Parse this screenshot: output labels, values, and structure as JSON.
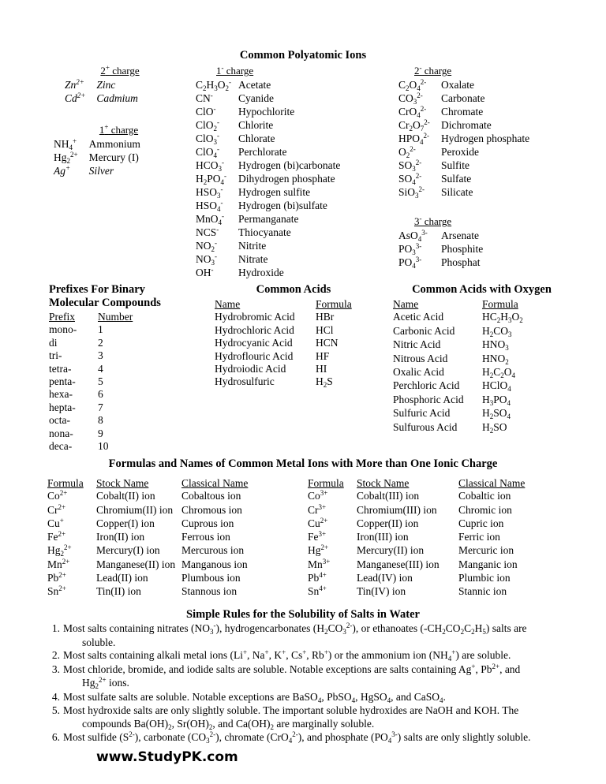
{
  "document": {
    "footer_brand": "www.StudyPK.com"
  },
  "polyatomic": {
    "title": "Common Polyatomic Ions",
    "groups": {
      "cat2": {
        "heading_charge": "2",
        "heading_sign": "+",
        "heading_word": "charge",
        "rows": [
          {
            "formula_base": "Zn",
            "formula_sup": "2+",
            "name": "Zinc",
            "italic": true
          },
          {
            "formula_base": "Cd",
            "formula_sup": "2+",
            "name": "Cadmium",
            "italic": true
          }
        ]
      },
      "cat1": {
        "heading_charge": "1",
        "heading_sign": "+",
        "heading_word": "charge",
        "rows": [
          {
            "formula_base": "NH",
            "formula_sub": "4",
            "formula_sup": "+",
            "name": "Ammonium",
            "italic": false
          },
          {
            "formula_base": "Hg",
            "formula_sub": "2",
            "formula_sup": "2+",
            "name": "Mercury (I)",
            "italic": false
          },
          {
            "formula_base": "Ag",
            "formula_sup": "+",
            "name": "Silver",
            "italic": true
          }
        ]
      },
      "an1": {
        "heading_charge": "1",
        "heading_sign": "-",
        "heading_word": "charge",
        "rows": [
          {
            "formula": "C2H3O2^-",
            "name": "Acetate"
          },
          {
            "formula": "CN^-",
            "name": "Cyanide"
          },
          {
            "formula": "ClO^-",
            "name": "Hypochlorite"
          },
          {
            "formula": "ClO2^-",
            "name": "Chlorite"
          },
          {
            "formula": "ClO3^-",
            "name": "Chlorate"
          },
          {
            "formula": "ClO4^-",
            "name": "Perchlorate"
          },
          {
            "formula": "HCO3^-",
            "name": "Hydrogen (bi)carbonate"
          },
          {
            "formula": "H2PO4^-",
            "name": "Dihydrogen phosphate"
          },
          {
            "formula": "HSO3^-",
            "name": "Hydrogen sulfite"
          },
          {
            "formula": "HSO4^-",
            "name": "Hydrogen (bi)sulfate"
          },
          {
            "formula": "MnO4^-",
            "name": "Permanganate"
          },
          {
            "formula": "NCS^-",
            "name": "Thiocyanate"
          },
          {
            "formula": "NO2^-",
            "name": "Nitrite"
          },
          {
            "formula": "NO3^-",
            "name": "Nitrate"
          },
          {
            "formula": "OH^-",
            "name": "Hydroxide"
          }
        ]
      },
      "an2": {
        "heading_charge": "2",
        "heading_sign": "-",
        "heading_word": "charge",
        "rows": [
          {
            "formula": "C2O4^2-",
            "name": "Oxalate"
          },
          {
            "formula": "CO3^2-",
            "name": "Carbonate"
          },
          {
            "formula": "CrO4^2-",
            "name": "Chromate"
          },
          {
            "formula": "Cr2O7^2-",
            "name": "Dichromate"
          },
          {
            "formula": "HPO4^2-",
            "name": "Hydrogen phosphate"
          },
          {
            "formula": "O2^2-",
            "name": "Peroxide"
          },
          {
            "formula": "SO3^2-",
            "name": "Sulfite"
          },
          {
            "formula": "SO4^2-",
            "name": "Sulfate"
          },
          {
            "formula": "SiO3^2-",
            "name": "Silicate"
          }
        ]
      },
      "an3": {
        "heading_charge": "3",
        "heading_sign": "-",
        "heading_word": "charge",
        "rows": [
          {
            "formula": "AsO4^3-",
            "name": "Arsenate"
          },
          {
            "formula": "PO3^3-",
            "name": "Phosphite"
          },
          {
            "formula": "PO4^3-",
            "name": "Phosphat"
          }
        ]
      }
    }
  },
  "prefixes": {
    "title_line1": "Prefixes For Binary",
    "title_line2": "Molecular Compounds",
    "col_prefix": "Prefix",
    "col_number": "Number",
    "rows": [
      {
        "prefix": "mono-",
        "number": "1"
      },
      {
        "prefix": "di",
        "number": "2"
      },
      {
        "prefix": "tri-",
        "number": "3"
      },
      {
        "prefix": "tetra-",
        "number": "4"
      },
      {
        "prefix": "penta-",
        "number": "5"
      },
      {
        "prefix": "hexa-",
        "number": "6"
      },
      {
        "prefix": "hepta-",
        "number": "7"
      },
      {
        "prefix": "octa-",
        "number": "8"
      },
      {
        "prefix": "nona-",
        "number": "9"
      },
      {
        "prefix": "deca-",
        "number": "10"
      }
    ]
  },
  "acids": {
    "title": "Common Acids",
    "col_name": "Name",
    "col_formula": "Formula",
    "rows": [
      {
        "name": "Hydrobromic Acid",
        "formula": "HBr"
      },
      {
        "name": "Hydrochloric Acid",
        "formula": "HCl"
      },
      {
        "name": "Hydrocyanic Acid",
        "formula": "HCN"
      },
      {
        "name": "Hydroflouric Acid",
        "formula": "HF"
      },
      {
        "name": "Hydroiodic Acid",
        "formula": "HI"
      },
      {
        "name": "Hydrosulfuric",
        "formula": "H2S"
      }
    ]
  },
  "oxyacids": {
    "title": "Common Acids with Oxygen",
    "col_name": "Name",
    "col_formula": "Formula",
    "rows": [
      {
        "name": "Acetic Acid",
        "formula": "HC2H3O2"
      },
      {
        "name": "Carbonic Acid",
        "formula": "H2CO3"
      },
      {
        "name": "Nitric Acid",
        "formula": "HNO3"
      },
      {
        "name": "Nitrous Acid",
        "formula": "HNO2"
      },
      {
        "name": "Oxalic Acid",
        "formula": "H2C2O4"
      },
      {
        "name": "Perchloric Acid",
        "formula": "HClO4"
      },
      {
        "name": "Phosphoric Acid",
        "formula": "H3PO4"
      },
      {
        "name": "Sulfuric Acid",
        "formula": "H2SO4"
      },
      {
        "name": "Sulfurous Acid",
        "formula": "H2SO"
      }
    ]
  },
  "metal_ions": {
    "title": "Formulas and Names of Common Metal Ions with More than One Ionic Charge",
    "col_formula": "Formula",
    "col_stock": "Stock Name",
    "col_classical": "Classical Name",
    "left_rows": [
      {
        "formula": "Co^2+",
        "stock": "Cobalt(II) ion",
        "classical": "Cobaltous ion"
      },
      {
        "formula": "Cr^2+",
        "stock": "Chromium(II) ion",
        "classical": "Chromous ion"
      },
      {
        "formula": "Cu^+",
        "stock": "Copper(I) ion",
        "classical": "Cuprous ion"
      },
      {
        "formula": "Fe^2+",
        "stock": "Iron(II) ion",
        "classical": "Ferrous ion"
      },
      {
        "formula": "Hg2^2+",
        "stock": "Mercury(I) ion",
        "classical": "Mercurous ion"
      },
      {
        "formula": "Mn^2+",
        "stock": "Manganese(II) ion",
        "classical": "Manganous ion"
      },
      {
        "formula": "Pb^2+",
        "stock": "Lead(II) ion",
        "classical": "Plumbous ion"
      },
      {
        "formula": "Sn^2+",
        "stock": "Tin(II) ion",
        "classical": "Stannous ion"
      }
    ],
    "right_rows": [
      {
        "formula": "Co^3+",
        "stock": "Cobalt(III) ion",
        "classical": "Cobaltic ion"
      },
      {
        "formula": "Cr^3+",
        "stock": "Chromium(III) ion",
        "classical": "Chromic ion"
      },
      {
        "formula": "Cu^2+",
        "stock": "Copper(II) ion",
        "classical": "Cupric ion"
      },
      {
        "formula": "Fe^3+",
        "stock": "Iron(III) ion",
        "classical": "Ferric ion"
      },
      {
        "formula": "Hg^2+",
        "stock": "Mercury(II) ion",
        "classical": "Mercuric ion"
      },
      {
        "formula": "Mn^3+",
        "stock": "Manganese(III) ion",
        "classical": "Manganic ion"
      },
      {
        "formula": "Pb^4+",
        "stock": "Lead(IV) ion",
        "classical": "Plumbic ion"
      },
      {
        "formula": "Sn^4+",
        "stock": "Tin(IV) ion",
        "classical": "Stannic ion"
      }
    ]
  },
  "solubility": {
    "title": "Simple Rules for the Solubility of Salts in Water",
    "rules": [
      {
        "num": "1.",
        "parts": [
          {
            "t": "Most salts containing nitrates ("
          },
          {
            "f": "NO3^-"
          },
          {
            "t": "), hydrogencarbonates ("
          },
          {
            "f": "H2CO3^2-"
          },
          {
            "t": "), or ethanoates ("
          },
          {
            "f": "-CH2CO2C2H5"
          },
          {
            "t": ") salts are"
          }
        ],
        "cont": [
          {
            "t": "soluble."
          }
        ]
      },
      {
        "num": "2.",
        "parts": [
          {
            "t": "Most salts containing alkali metal ions ("
          },
          {
            "f": "Li^+"
          },
          {
            "t": ", "
          },
          {
            "f": "Na^+"
          },
          {
            "t": ", "
          },
          {
            "f": "K^+"
          },
          {
            "t": ", "
          },
          {
            "f": "Cs^+"
          },
          {
            "t": ", "
          },
          {
            "f": "Rb^+"
          },
          {
            "t": ") or the ammonium ion ("
          },
          {
            "f": "NH4^+"
          },
          {
            "t": ") are soluble."
          }
        ],
        "cont": []
      },
      {
        "num": "3.",
        "parts": [
          {
            "t": "Most chloride, bromide, and iodide salts are soluble.  Notable exceptions are salts containing "
          },
          {
            "f": "Ag^+"
          },
          {
            "t": ", "
          },
          {
            "f": "Pb^2+"
          },
          {
            "t": ", and"
          }
        ],
        "cont": [
          {
            "f": "Hg2^2+"
          },
          {
            "t": " ions."
          }
        ]
      },
      {
        "num": "4.",
        "parts": [
          {
            "t": "Most sulfate salts are soluble.  Notable exceptions are "
          },
          {
            "f": "BaSO4"
          },
          {
            "t": ", "
          },
          {
            "f": "PbSO4"
          },
          {
            "t": ", "
          },
          {
            "f": "HgSO4"
          },
          {
            "t": ", and "
          },
          {
            "f": "CaSO4"
          },
          {
            "t": "."
          }
        ],
        "cont": []
      },
      {
        "num": "5.",
        "parts": [
          {
            "t": "Most hydroxide salts are only slightly soluble.  The important soluble hydroxides are NaOH and KOH.  The"
          }
        ],
        "cont": [
          {
            "t": "compounds "
          },
          {
            "f": "Ba(OH)2"
          },
          {
            "t": ", "
          },
          {
            "f": "Sr(OH)2"
          },
          {
            "t": ", and "
          },
          {
            "f": "Ca(OH)2"
          },
          {
            "t": " are marginally soluble."
          }
        ]
      },
      {
        "num": "6.",
        "parts": [
          {
            "t": "Most sulfide ("
          },
          {
            "f": "S^2-"
          },
          {
            "t": "), carbonate ("
          },
          {
            "f": "CO3^2-"
          },
          {
            "t": "), chromate ("
          },
          {
            "f": "CrO4^2-"
          },
          {
            "t": "), and phosphate ("
          },
          {
            "f": "PO4^3-"
          },
          {
            "t": ") salts are only slightly soluble."
          }
        ],
        "cont": []
      }
    ]
  }
}
